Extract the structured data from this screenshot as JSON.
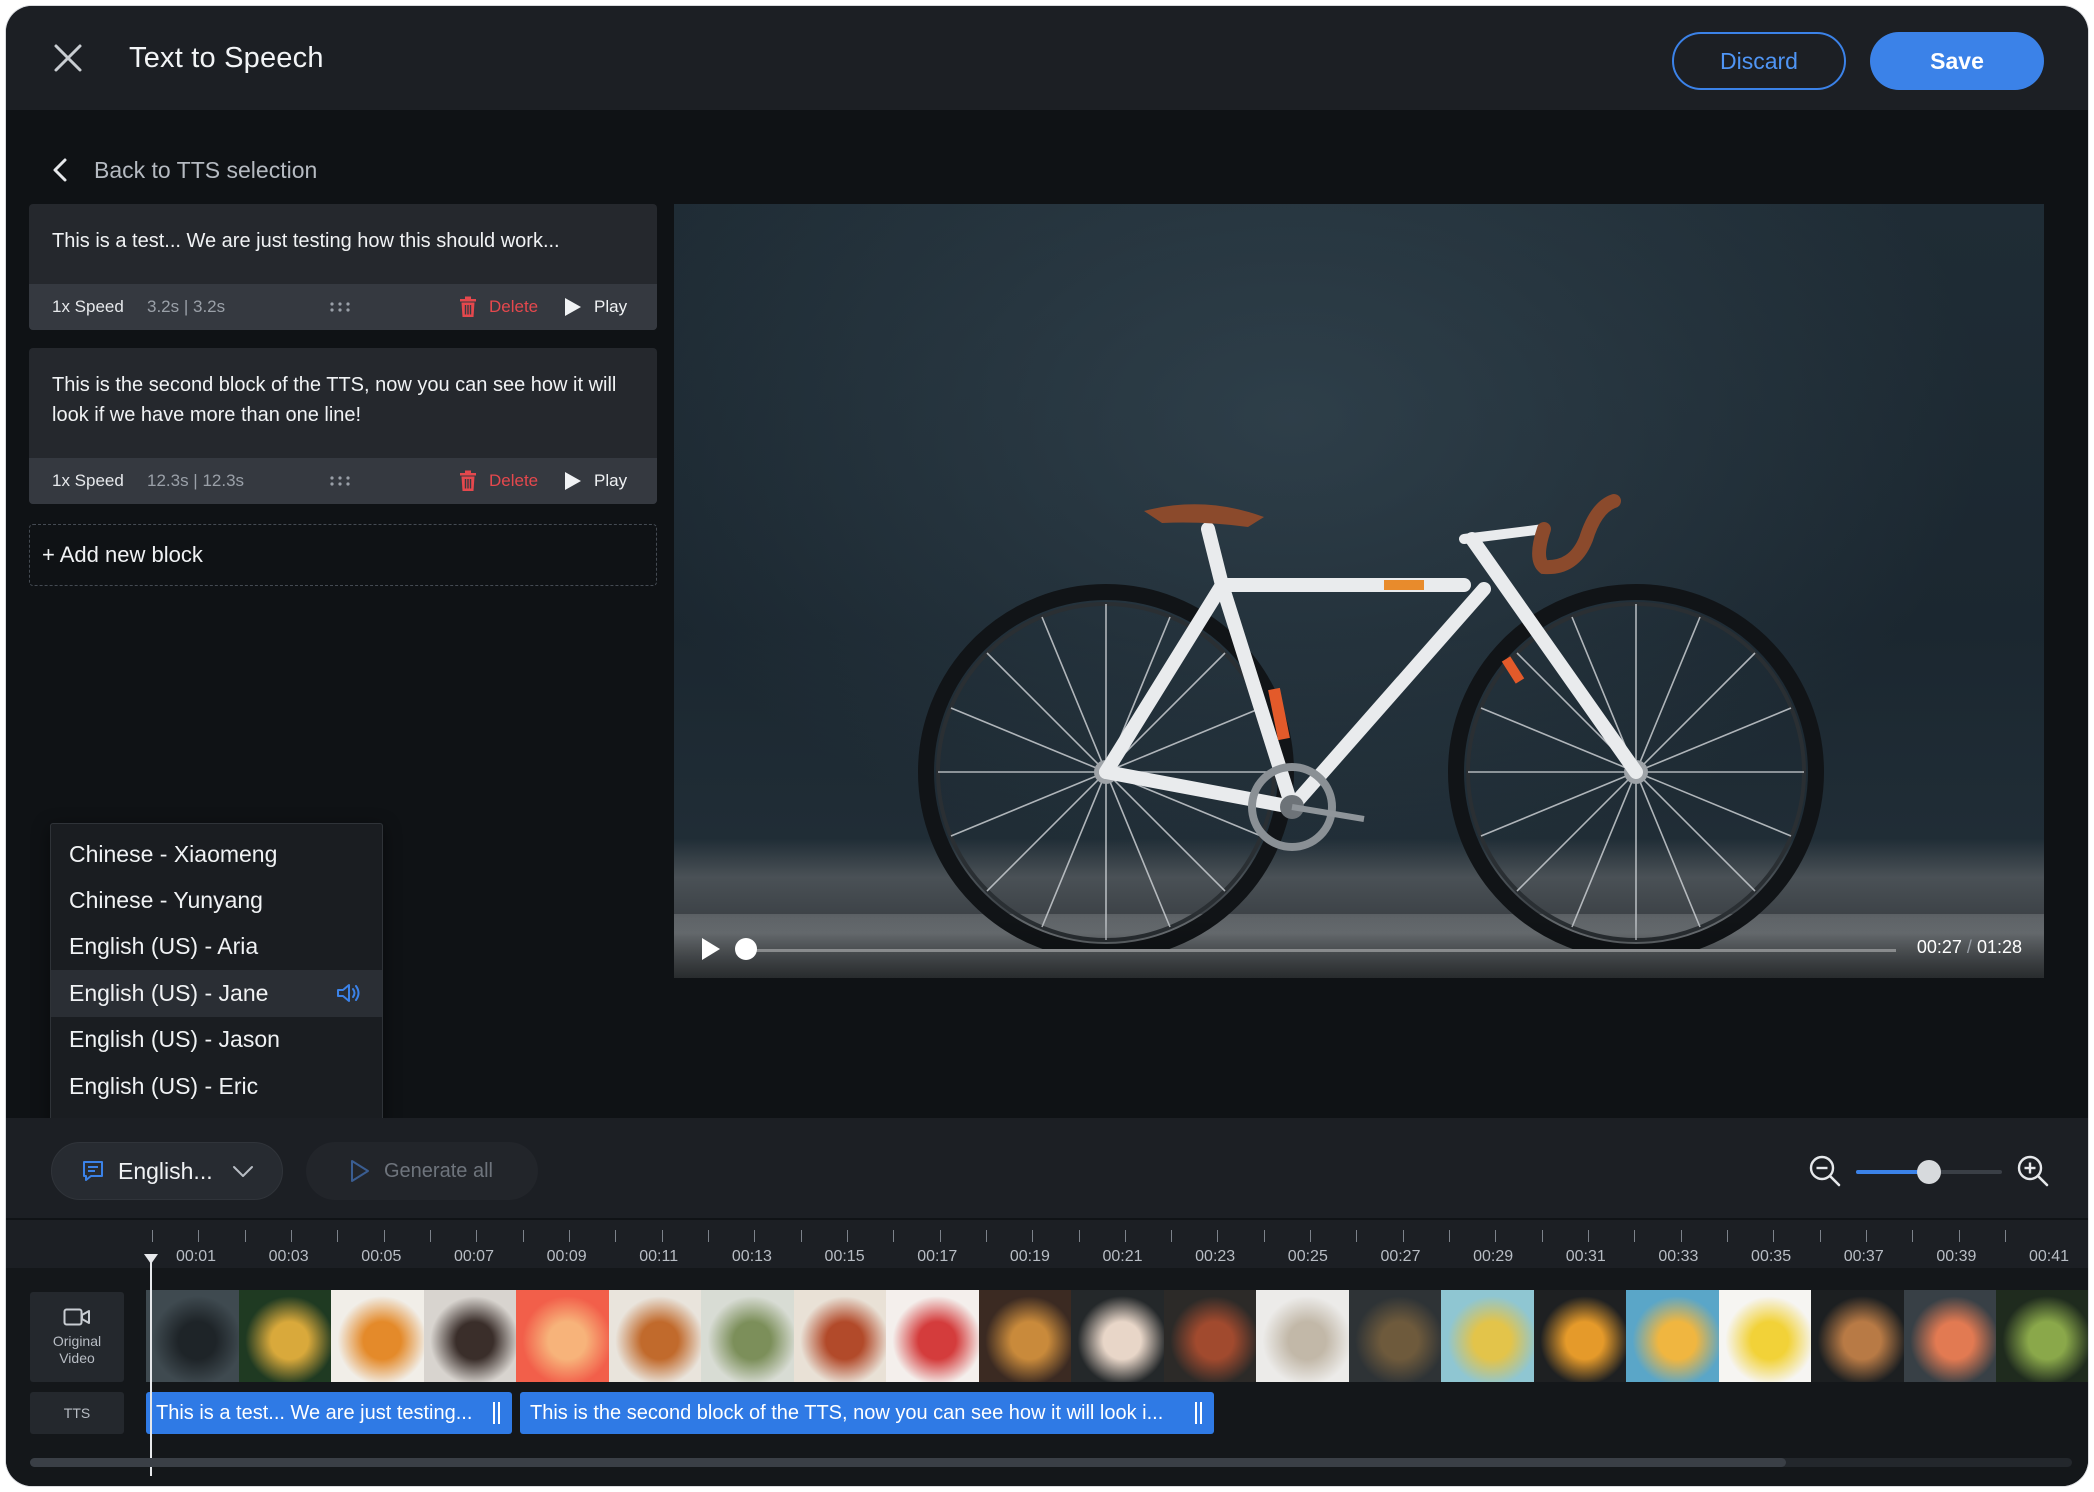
{
  "header": {
    "title": "Text to Speech",
    "discard_label": "Discard",
    "save_label": "Save"
  },
  "back_link": {
    "label": "Back to TTS selection"
  },
  "blocks": [
    {
      "text": "This is a test... We are just testing how this should work...",
      "speed": "1x Speed",
      "duration": "3.2s | 3.2s",
      "delete_label": "Delete",
      "play_label": "Play"
    },
    {
      "text": "This is the second block of the TTS, now you can see how it will look if we have more than one line!",
      "speed": "1x Speed",
      "duration": "12.3s | 12.3s",
      "delete_label": "Delete",
      "play_label": "Play"
    }
  ],
  "add_block_label": "+ Add new block",
  "video": {
    "current_time": "00:27",
    "separator": "/",
    "total_time": "01:28",
    "progress": 0.0
  },
  "voices": {
    "items": [
      "Chinese - Xiaomeng",
      "Chinese - Yunyang",
      "English (US) - Aria",
      "English (US) - Jane",
      "English (US) - Jason",
      "English (US) - Eric"
    ],
    "selected_index": 3
  },
  "toolbar": {
    "language_label": "English...",
    "generate_all_label": "Generate all",
    "zoom_level": 0.5
  },
  "timeline": {
    "ticks": [
      "00:01",
      "00:03",
      "00:05",
      "00:07",
      "00:09",
      "00:11",
      "00:13",
      "00:15",
      "00:17",
      "00:19",
      "00:21",
      "00:23",
      "00:25",
      "00:27",
      "00:29",
      "00:31",
      "00:33",
      "00:35",
      "00:37",
      "00:39",
      "00:41"
    ],
    "rows": {
      "video_label": "Original Video",
      "tts_label": "TTS"
    },
    "clips": [
      {
        "label": "This is a test... We are just testing..."
      },
      {
        "label": "This is the second block of the TTS, now you can see how it will look i..."
      }
    ]
  },
  "colors": {
    "accent": "#3b82e8",
    "danger": "#e5484d",
    "background": "#0f1215",
    "panel": "#1c1f24"
  }
}
